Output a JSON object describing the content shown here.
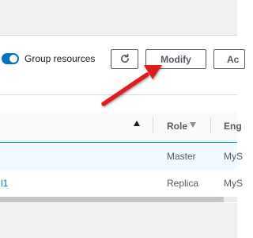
{
  "toolbar": {
    "group_resources_label": "Group resources",
    "group_resources_on": true,
    "refresh_icon": "refresh-icon",
    "modify_label": "Modify",
    "actions_label_partial": "Ac"
  },
  "table": {
    "columns": [
      {
        "label": "Role",
        "sort": "descending-indicator"
      },
      {
        "label": "Eng",
        "sort": null
      }
    ],
    "sorted_column_indicator": "sort-ascending",
    "rows": [
      {
        "name": "",
        "role": "Master",
        "engine": "MyS",
        "selected": true
      },
      {
        "name": "l1",
        "role": "Replica",
        "engine": "MyS",
        "selected": false
      }
    ]
  },
  "annotation": {
    "arrow_color": "#e01e1e",
    "points_to": "modify-button"
  },
  "colors": {
    "accent": "#0073bb",
    "selected_row_bg": "#f1faff",
    "selected_row_border": "#00a1c9"
  }
}
